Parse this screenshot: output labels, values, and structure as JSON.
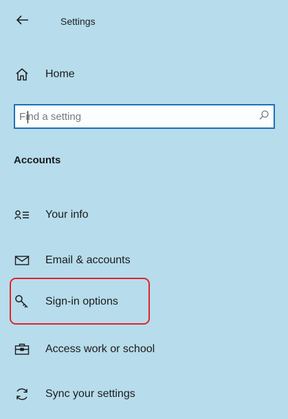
{
  "header": {
    "title": "Settings",
    "back_icon": "back-arrow-icon"
  },
  "home": {
    "label": "Home",
    "icon": "home-icon"
  },
  "search": {
    "placeholder": "Find a setting",
    "value": "",
    "icon": "search-icon"
  },
  "section": {
    "title": "Accounts"
  },
  "nav": {
    "items": [
      {
        "label": "Your info",
        "icon": "person-card-icon"
      },
      {
        "label": "Email & accounts",
        "icon": "mail-icon"
      },
      {
        "label": "Sign-in options",
        "icon": "key-icon",
        "highlighted": true
      },
      {
        "label": "Access work or school",
        "icon": "briefcase-icon"
      },
      {
        "label": "Sync your settings",
        "icon": "sync-icon"
      }
    ]
  },
  "colors": {
    "background": "#b7dcec",
    "search_border": "#1f6fb5",
    "highlight_border": "#e02424"
  }
}
